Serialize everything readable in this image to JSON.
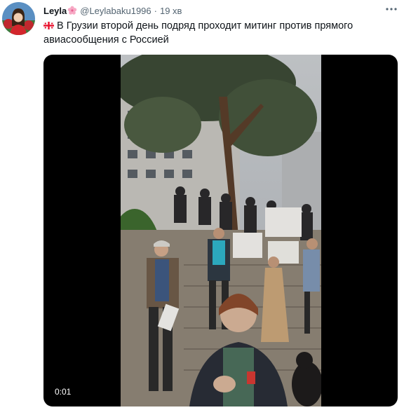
{
  "tweet": {
    "author_name": "Leyla",
    "name_emoji": "cherry-blossom-icon",
    "handle": "@Leylabaku1996",
    "separator": "·",
    "time": "19 хв",
    "flag_icon": "georgia-flag-icon",
    "text": "В Грузии второй день подряд проходит митинг против прямого авиасообщения с Россией"
  },
  "video": {
    "timestamp": "0:01"
  },
  "colors": {
    "text_primary": "#0f1419",
    "text_secondary": "#536471",
    "media_background": "#000000"
  }
}
